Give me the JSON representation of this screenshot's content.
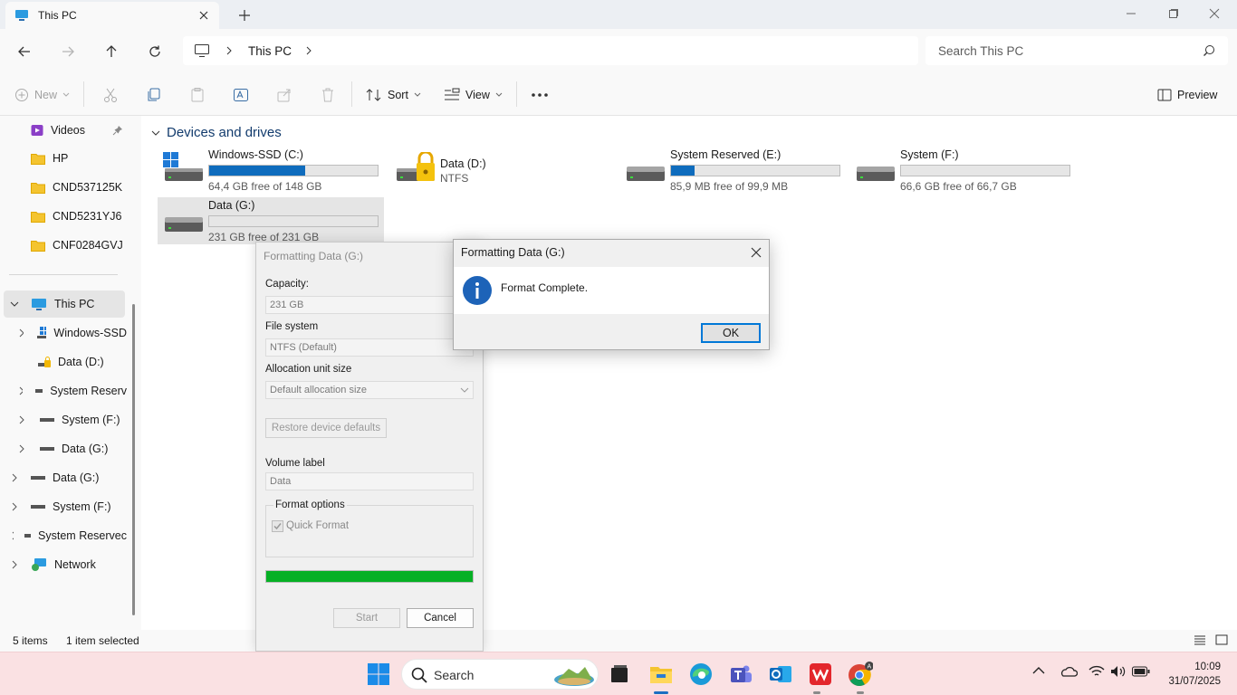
{
  "window": {
    "tab_title": "This PC",
    "breadcrumb": "This PC",
    "search_placeholder": "Search This PC"
  },
  "commands": {
    "new": "New",
    "sort": "Sort",
    "view": "View",
    "preview": "Preview"
  },
  "sidebar": {
    "quick": [
      {
        "label": "Videos",
        "icon": "videos-icon",
        "pinned": true
      },
      {
        "label": "HP",
        "icon": "folder-icon"
      },
      {
        "label": "CND537125K",
        "icon": "folder-icon"
      },
      {
        "label": "CND5231YJ6",
        "icon": "folder-icon"
      },
      {
        "label": "CNF0284GVJ",
        "icon": "folder-icon"
      }
    ],
    "tree": [
      {
        "label": "This PC",
        "icon": "pc-icon",
        "expanded": true,
        "selected": true
      },
      {
        "label": "Windows-SSD",
        "icon": "windows-drive-icon"
      },
      {
        "label": "Data (D:)",
        "icon": "locked-drive-icon"
      },
      {
        "label": "System Reserv",
        "icon": "drive-icon"
      },
      {
        "label": "System (F:)",
        "icon": "drive-icon"
      },
      {
        "label": "Data (G:)",
        "icon": "drive-icon"
      },
      {
        "label": "Data (G:)",
        "icon": "drive-icon"
      },
      {
        "label": "System (F:)",
        "icon": "drive-icon"
      },
      {
        "label": "System Reservec",
        "icon": "drive-icon"
      },
      {
        "label": "Network",
        "icon": "network-icon"
      }
    ]
  },
  "main": {
    "group_title": "Devices and drives",
    "drives": [
      {
        "name": "Windows-SSD (C:)",
        "free": "64,4 GB free of 148 GB",
        "used_fraction": 0.57,
        "icon": "windows-drive-icon"
      },
      {
        "name": "Data (D:)",
        "free": "NTFS",
        "icon": "locked-drive-icon"
      },
      {
        "name": "System Reserved (E:)",
        "free": "85,9 MB free of 99,9 MB",
        "used_fraction": 0.14,
        "icon": "drive-icon"
      },
      {
        "name": "System (F:)",
        "free": "66,6 GB free of 66,7 GB",
        "used_fraction": 0.0,
        "icon": "drive-icon"
      },
      {
        "name": "Data (G:)",
        "free": "231 GB free of 231 GB",
        "used_fraction": 0.0,
        "icon": "drive-icon",
        "selected": true
      }
    ]
  },
  "status": {
    "items": "5 items",
    "selected": "1 item selected"
  },
  "format_dialog": {
    "title": "Formatting Data (G:)",
    "capacity_label": "Capacity:",
    "capacity_value": "231 GB",
    "fs_label": "File system",
    "fs_value": "NTFS (Default)",
    "alloc_label": "Allocation unit size",
    "alloc_value": "Default allocation size",
    "restore_label": "Restore device defaults",
    "volume_label": "Volume label",
    "volume_value": "Data",
    "options_label": "Format options",
    "quick_format": "Quick Format",
    "progress": 1.0,
    "start": "Start",
    "cancel": "Cancel"
  },
  "message_box": {
    "title": "Formatting Data (G:)",
    "text": "Format Complete.",
    "ok": "OK"
  },
  "taskbar": {
    "search": "Search",
    "time": "10:09",
    "date": "31/07/2025"
  },
  "colors": {
    "accent": "#0f6cbd",
    "progress": "#06b025",
    "taskbar": "#fae1e3"
  }
}
